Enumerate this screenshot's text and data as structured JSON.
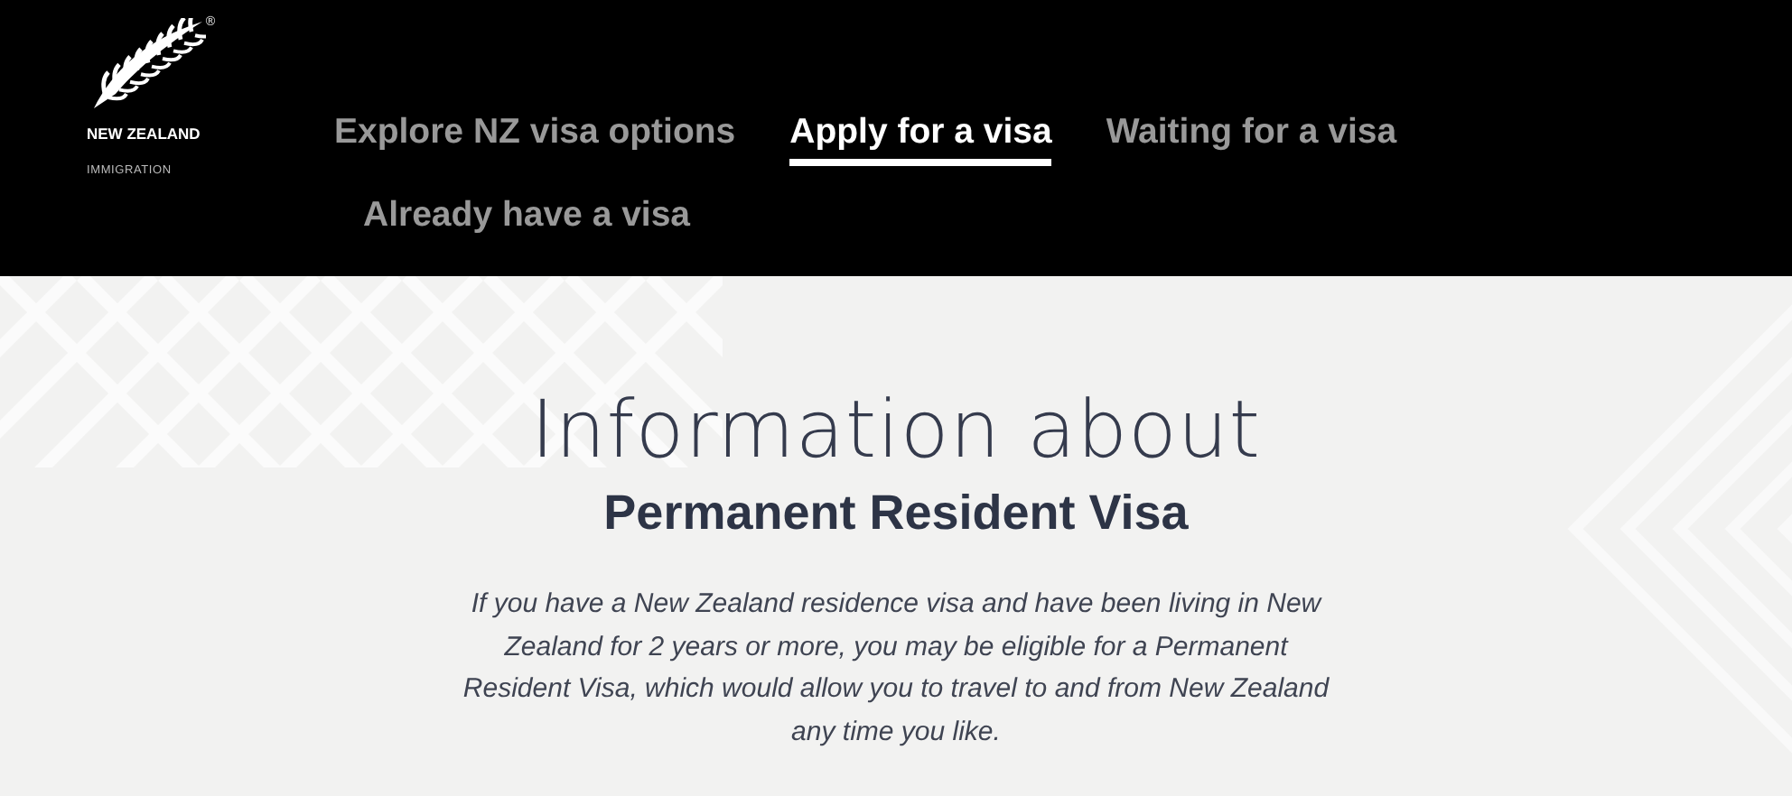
{
  "logo": {
    "name": "NEW ZEALAND",
    "subtitle": "IMMIGRATION",
    "mark": "®"
  },
  "nav": [
    {
      "label": "Explore NZ visa options",
      "selected": false
    },
    {
      "label": "Apply for a visa",
      "selected": true
    },
    {
      "label": "Waiting for a visa",
      "selected": false
    },
    {
      "label": "Already have a visa",
      "selected": false
    }
  ],
  "hero": {
    "heading": "Information about",
    "subheading": "Permanent Resident Visa",
    "description": "If you have a New Zealand residence visa and have been living in New Zealand for 2 years or more, you may be eligible for a Permanent Resident Visa, which would allow you to travel to and from New Zealand any time you like."
  }
}
